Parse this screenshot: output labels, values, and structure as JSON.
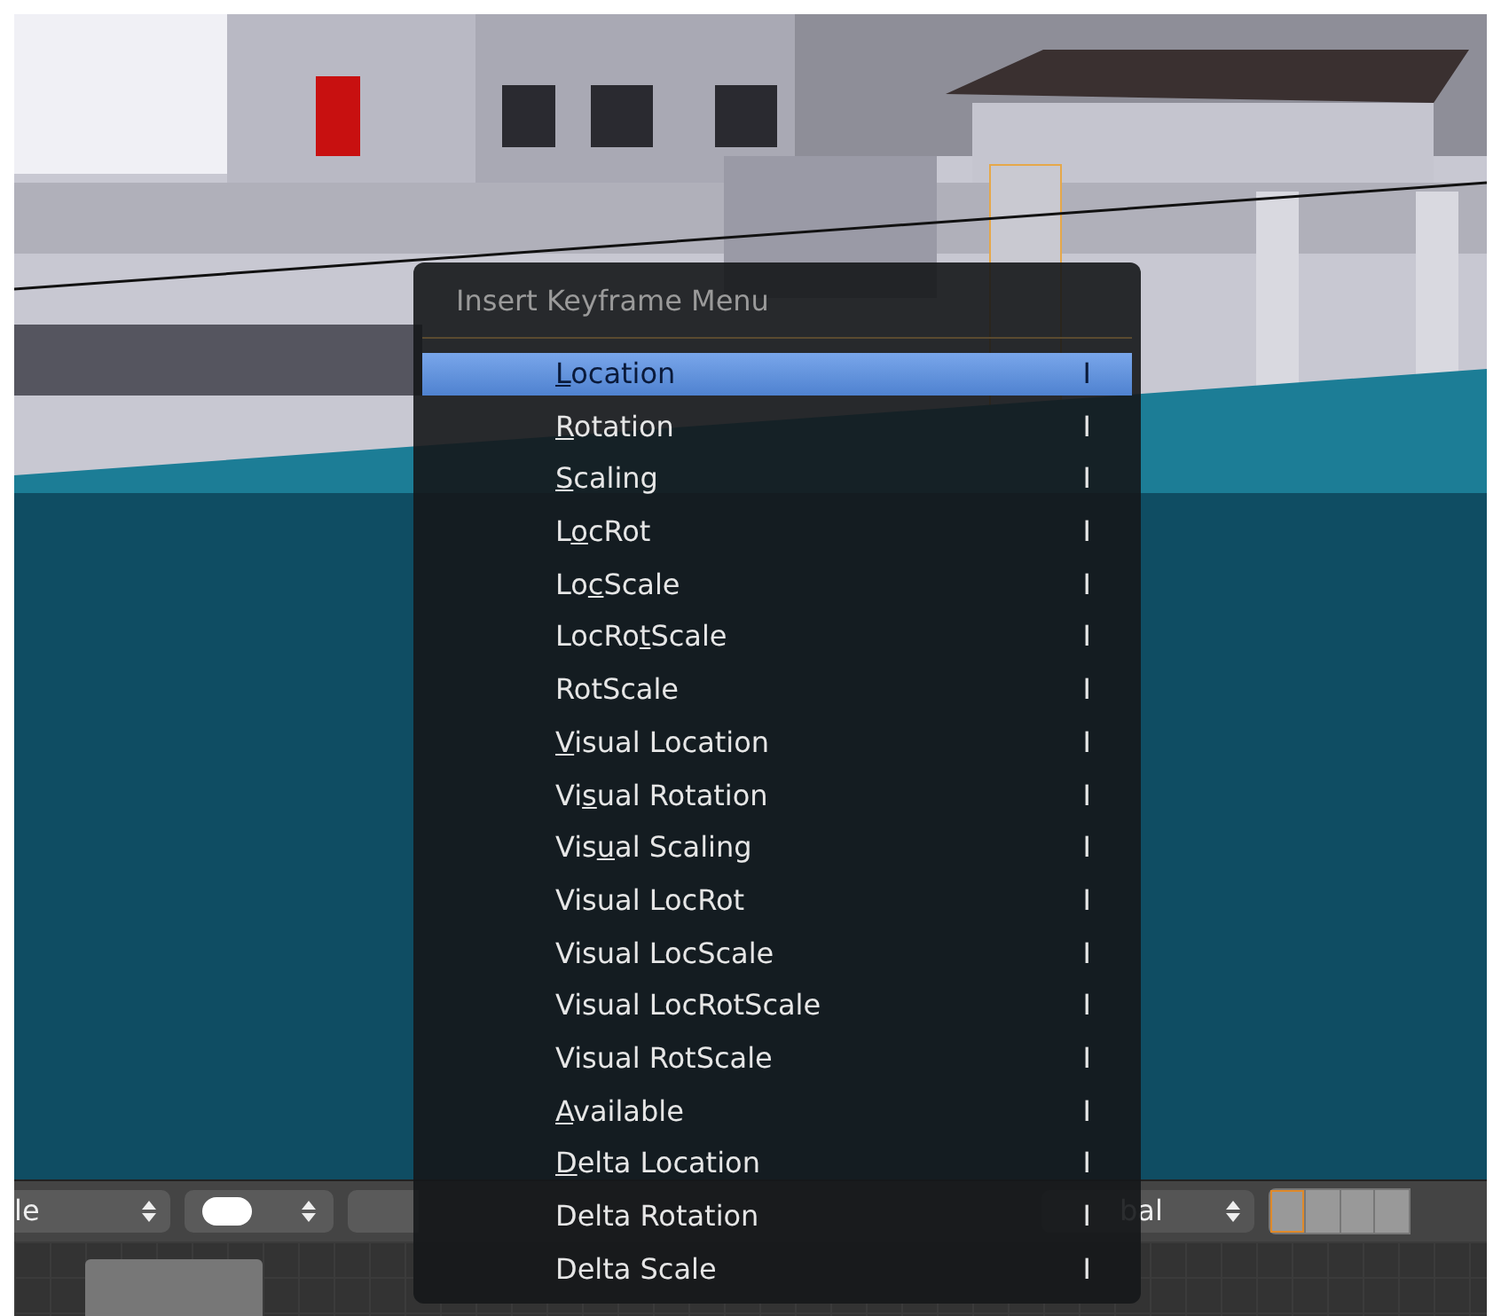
{
  "menu": {
    "title": "Insert Keyframe Menu",
    "items": [
      {
        "label": {
          "underlined": "L",
          "after": "ocation"
        },
        "shortcut": "I",
        "selected": true
      },
      {
        "label": {
          "underlined": "R",
          "after": "otation"
        },
        "shortcut": "I",
        "selected": false
      },
      {
        "label": {
          "underlined": "S",
          "after": "caling"
        },
        "shortcut": "I",
        "selected": false
      },
      {
        "label": {
          "before": "L",
          "underlined": "o",
          "after": "cRot"
        },
        "shortcut": "I",
        "selected": false
      },
      {
        "label": {
          "before": "Lo",
          "underlined": "c",
          "after": "Scale"
        },
        "shortcut": "I",
        "selected": false
      },
      {
        "label": {
          "before": "LocRo",
          "underlined": "t",
          "after": "Scale"
        },
        "shortcut": "I",
        "selected": false
      },
      {
        "label": {
          "before": "RotScale"
        },
        "shortcut": "I",
        "selected": false
      },
      {
        "label": {
          "underlined": "V",
          "after": "isual Location"
        },
        "shortcut": "I",
        "selected": false
      },
      {
        "label": {
          "before": "Vi",
          "underlined": "s",
          "after": "ual Rotation"
        },
        "shortcut": "I",
        "selected": false
      },
      {
        "label": {
          "before": "Vis",
          "underlined": "u",
          "after": "al Scaling"
        },
        "shortcut": "I",
        "selected": false
      },
      {
        "label": {
          "before": "Visual LocRot"
        },
        "shortcut": "I",
        "selected": false
      },
      {
        "label": {
          "before": "Visual LocScale"
        },
        "shortcut": "I",
        "selected": false
      },
      {
        "label": {
          "before": "Visual LocRotScale"
        },
        "shortcut": "I",
        "selected": false
      },
      {
        "label": {
          "before": "Visual RotScale"
        },
        "shortcut": "I",
        "selected": false
      },
      {
        "label": {
          "underlined": "A",
          "after": "vailable"
        },
        "shortcut": "I",
        "selected": false
      },
      {
        "label": {
          "underlined": "D",
          "after": "elta Location"
        },
        "shortcut": "I",
        "selected": false
      },
      {
        "label": {
          "before": "Delta Rotation"
        },
        "shortcut": "I",
        "selected": false
      },
      {
        "label": {
          "before": "Delta Scale"
        },
        "shortcut": "I",
        "selected": false
      }
    ]
  },
  "header": {
    "mode_dropdown": "le",
    "orientation_dropdown": "bal"
  }
}
